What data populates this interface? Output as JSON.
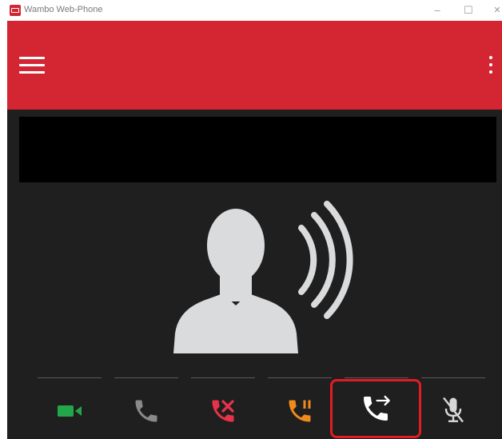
{
  "window": {
    "title": "Wambo Web-Phone",
    "controls": {
      "minimize": "–",
      "maximize": "☐",
      "close": "✕"
    }
  },
  "header": {
    "color": "#d32632",
    "menu_icon": "hamburger-menu-icon",
    "more_icon": "more-vertical-icon"
  },
  "call": {
    "name_bar_text": "",
    "avatar_icon": "person-speaking-icon"
  },
  "controls": [
    {
      "name": "video",
      "icon": "video-camera-icon",
      "color": "#22a84a"
    },
    {
      "name": "answer",
      "icon": "phone-icon",
      "color": "#8a8a8a"
    },
    {
      "name": "hangup",
      "icon": "phone-hangup-icon",
      "color": "#e8324a"
    },
    {
      "name": "hold",
      "icon": "phone-hold-icon",
      "color": "#f08a1c"
    },
    {
      "name": "transfer",
      "icon": "phone-transfer-icon",
      "color": "#ffffff",
      "highlighted": true
    },
    {
      "name": "mute",
      "icon": "microphone-muted-icon",
      "color": "#d8d8d8"
    }
  ]
}
